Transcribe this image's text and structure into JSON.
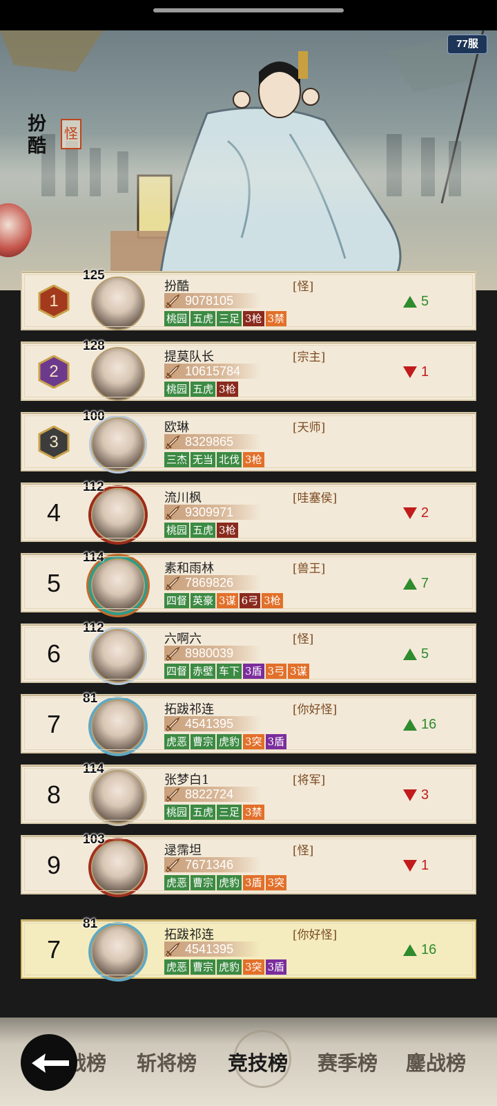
{
  "header": {
    "server_badge": "77服",
    "featured_player": {
      "name": "扮酷",
      "title": "怪"
    }
  },
  "ranking": [
    {
      "rank": "1",
      "level": "125",
      "name": "扮酷",
      "title": "[怪]",
      "power": "9078105",
      "tags": [
        {
          "text": "桃园",
          "color": "green"
        },
        {
          "text": "五虎",
          "color": "green"
        },
        {
          "text": "三足",
          "color": "green"
        },
        {
          "text": "3枪",
          "color": "red"
        },
        {
          "text": "3禁",
          "color": "orange"
        }
      ],
      "change": {
        "dir": "up",
        "value": "5"
      }
    },
    {
      "rank": "2",
      "level": "128",
      "name": "提莫队长",
      "title": "[宗主]",
      "power": "10615784",
      "tags": [
        {
          "text": "桃园",
          "color": "green"
        },
        {
          "text": "五虎",
          "color": "green"
        },
        {
          "text": "3枪",
          "color": "red"
        }
      ],
      "change": {
        "dir": "down",
        "value": "1"
      }
    },
    {
      "rank": "3",
      "level": "100",
      "name": "欧琳",
      "title": "[天师]",
      "power": "8329865",
      "tags": [
        {
          "text": "三杰",
          "color": "green"
        },
        {
          "text": "无当",
          "color": "green"
        },
        {
          "text": "北伐",
          "color": "green"
        },
        {
          "text": "3枪",
          "color": "orange"
        }
      ],
      "change": null
    },
    {
      "rank": "4",
      "level": "112",
      "name": "流川枫",
      "title": "[哇塞侯]",
      "power": "9309971",
      "tags": [
        {
          "text": "桃园",
          "color": "green"
        },
        {
          "text": "五虎",
          "color": "green"
        },
        {
          "text": "3枪",
          "color": "red"
        }
      ],
      "change": {
        "dir": "down",
        "value": "2"
      }
    },
    {
      "rank": "5",
      "level": "114",
      "name": "素和雨林",
      "title": "[兽王]",
      "power": "7869826",
      "tags": [
        {
          "text": "四督",
          "color": "green"
        },
        {
          "text": "英豪",
          "color": "green"
        },
        {
          "text": "3谋",
          "color": "orange"
        },
        {
          "text": "6弓",
          "color": "red"
        },
        {
          "text": "3枪",
          "color": "orange"
        }
      ],
      "change": {
        "dir": "up",
        "value": "7"
      }
    },
    {
      "rank": "6",
      "level": "112",
      "name": "六啊六",
      "title": "[怪]",
      "power": "8980039",
      "tags": [
        {
          "text": "四督",
          "color": "green"
        },
        {
          "text": "赤壁",
          "color": "green"
        },
        {
          "text": "车下",
          "color": "green"
        },
        {
          "text": "3盾",
          "color": "purple"
        },
        {
          "text": "3弓",
          "color": "orange"
        },
        {
          "text": "3谋",
          "color": "orange"
        }
      ],
      "change": {
        "dir": "up",
        "value": "5"
      }
    },
    {
      "rank": "7",
      "level": "81",
      "name": "拓跋祁连",
      "title": "[你好怪]",
      "power": "4541395",
      "tags": [
        {
          "text": "虎恶",
          "color": "green"
        },
        {
          "text": "曹宗",
          "color": "green"
        },
        {
          "text": "虎豹",
          "color": "green"
        },
        {
          "text": "3突",
          "color": "orange"
        },
        {
          "text": "3盾",
          "color": "purple"
        }
      ],
      "change": {
        "dir": "up",
        "value": "16"
      }
    },
    {
      "rank": "8",
      "level": "114",
      "name": "张梦白1",
      "title": "[将军]",
      "power": "8822724",
      "tags": [
        {
          "text": "桃园",
          "color": "green"
        },
        {
          "text": "五虎",
          "color": "green"
        },
        {
          "text": "三足",
          "color": "green"
        },
        {
          "text": "3禁",
          "color": "orange"
        }
      ],
      "change": {
        "dir": "down",
        "value": "3"
      }
    },
    {
      "rank": "9",
      "level": "103",
      "name": "逯霈坦",
      "title": "[怪]",
      "power": "7671346",
      "tags": [
        {
          "text": "虎恶",
          "color": "green"
        },
        {
          "text": "曹宗",
          "color": "green"
        },
        {
          "text": "虎豹",
          "color": "green"
        },
        {
          "text": "3盾",
          "color": "orange"
        },
        {
          "text": "3突",
          "color": "orange"
        }
      ],
      "change": {
        "dir": "down",
        "value": "1"
      }
    }
  ],
  "my_rank": {
    "rank": "7",
    "level": "81",
    "name": "拓跋祁连",
    "title": "[你好怪]",
    "power": "4541395",
    "tags": [
      {
        "text": "虎恶",
        "color": "green"
      },
      {
        "text": "曹宗",
        "color": "green"
      },
      {
        "text": "虎豹",
        "color": "green"
      },
      {
        "text": "3突",
        "color": "orange"
      },
      {
        "text": "3盾",
        "color": "purple"
      }
    ],
    "change": {
      "dir": "up",
      "value": "16"
    }
  },
  "tabs": [
    {
      "label": "战榜",
      "active": false
    },
    {
      "label": "斩将榜",
      "active": false
    },
    {
      "label": "竞技榜",
      "active": true
    },
    {
      "label": "赛季榜",
      "active": false
    },
    {
      "label": "鏖战榜",
      "active": false
    }
  ],
  "colors": {
    "tag_green": "#3c8a43",
    "tag_red": "#8a2a1e",
    "tag_orange": "#e2702a",
    "tag_purple": "#7a2d9c",
    "up": "#2e8b2e",
    "down": "#c11b1b"
  }
}
